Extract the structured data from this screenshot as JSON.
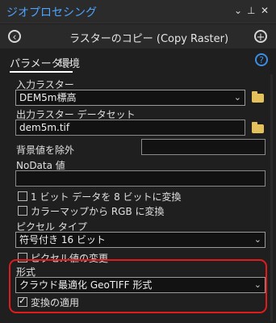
{
  "window": {
    "title": "ジオプロセシング",
    "controls": {
      "dropdown": "⌄",
      "pin": "⊥",
      "close": "✕"
    }
  },
  "tool": {
    "heading": "ラスターのコピー (Copy Raster)"
  },
  "tabs": [
    {
      "label": "パラメーター"
    },
    {
      "label": "環境"
    }
  ],
  "params": {
    "input_raster": {
      "label": "入力ラスター",
      "value": "DEM5m標高"
    },
    "output_dataset": {
      "label": "出力ラスター データセット",
      "value": "dem5m.tif"
    },
    "ignore_background": {
      "label": "背景値を除外",
      "value": ""
    },
    "nodata": {
      "label": "NoData 値",
      "value": ""
    },
    "convert_1bit": {
      "label": "1 ビット データを 8 ビットに変換",
      "checked": false
    },
    "colormap_rgb": {
      "label": "カラーマップから RGB に変換",
      "checked": false
    },
    "pixel_type": {
      "label": "ピクセル タイプ",
      "value": "符号付き 16 ビット"
    },
    "change_pixel": {
      "label": "ピクセル値の変更",
      "checked": false
    },
    "format": {
      "label": "形式",
      "value": "クラウド最適化 GeoTIFF 形式"
    },
    "apply_transform": {
      "label": "変換の適用",
      "checked": true
    }
  },
  "colors": {
    "accent": "#4da3ff",
    "highlight": "#e11b1b",
    "folder": "#e4c15a"
  }
}
